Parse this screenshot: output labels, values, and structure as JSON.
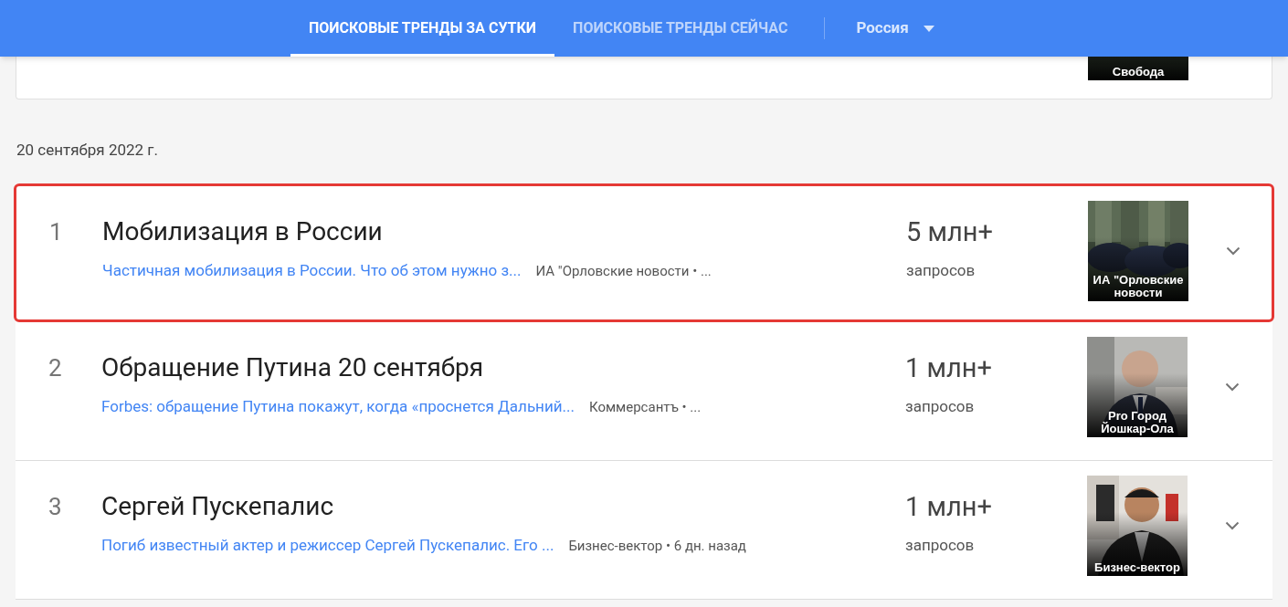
{
  "header": {
    "tabs": [
      {
        "label": "ПОИСКОВЫЕ ТРЕНДЫ ЗА СУТКИ",
        "selected": true
      },
      {
        "label": "ПОИСКОВЫЕ ТРЕНДЫ СЕЙЧАС",
        "selected": false
      }
    ],
    "region": "Россия"
  },
  "previous_card": {
    "thumbnail_caption": "Свобода"
  },
  "date": "20 сентября 2022 г.",
  "trends": [
    {
      "rank": "1",
      "title": "Мобилизация в России",
      "article": "Частичная мобилизация в России. Что об этом нужно з...",
      "source": "ИА \"Орловские новости • ...",
      "count": "5 млн+",
      "count_label": "запросов",
      "thumbnail_caption": "ИА \"Орловские новости",
      "highlighted": true
    },
    {
      "rank": "2",
      "title": "Обращение Путина 20 сентября",
      "article": "Forbes: обращение Путина покажут, когда «проснется Дальний...",
      "source": "Коммерсантъ • ...",
      "count": "1 млн+",
      "count_label": "запросов",
      "thumbnail_caption": "Pro Город Йошкар-Ола",
      "highlighted": false
    },
    {
      "rank": "3",
      "title": "Сергей Пускепалис",
      "article": "Погиб известный актер и режиссер Сергей Пускепалис. Его ...",
      "source": "Бизнес-вектор • 6 дн. назад",
      "count": "1 млн+",
      "count_label": "запросов",
      "thumbnail_caption": "Бизнес-вектор",
      "highlighted": false
    }
  ]
}
